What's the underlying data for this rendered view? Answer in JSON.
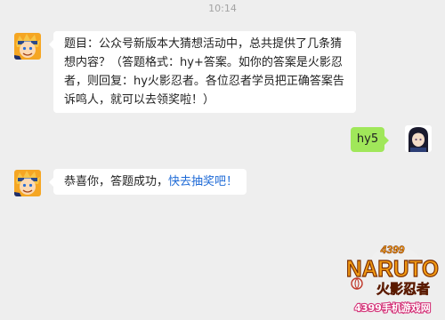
{
  "chat": {
    "timestamp": "10:14",
    "messages": [
      {
        "sender": "bot",
        "text": "题目：公众号新版本大猜想活动中，总共提供了几条猜想内容？（答题格式：hy+答案。如你的答案是火影忍者，则回复：hy火影忍者。各位忍者学员把正确答案告诉鸣人，就可以去领奖啦！）",
        "lines": [
          "题目：公众号新版本大猜想活动中，总共提供了几条猜",
          "想内容？（答题格式：hy+答案。如你的答案是火影忍",
          "者，则回复：hy火影忍者。各位忍者学员把正确答案告",
          "诉鸣人，就可以去领奖啦！）"
        ]
      },
      {
        "sender": "user",
        "text": "hy5"
      },
      {
        "sender": "bot",
        "text_prefix": "恭喜你，答题成功，",
        "link_text": "快去抽奖吧！"
      }
    ]
  },
  "watermark": {
    "top_text": "4399",
    "logo_text": "NARUTO",
    "sub_text": "火影忍者",
    "site_text": "4399手机游戏网"
  },
  "colors": {
    "background": "#eeeeee",
    "bubble_in": "#ffffff",
    "bubble_out": "#a0e75a",
    "link": "#1e6ad6",
    "timestamp": "#a3a3a3"
  }
}
